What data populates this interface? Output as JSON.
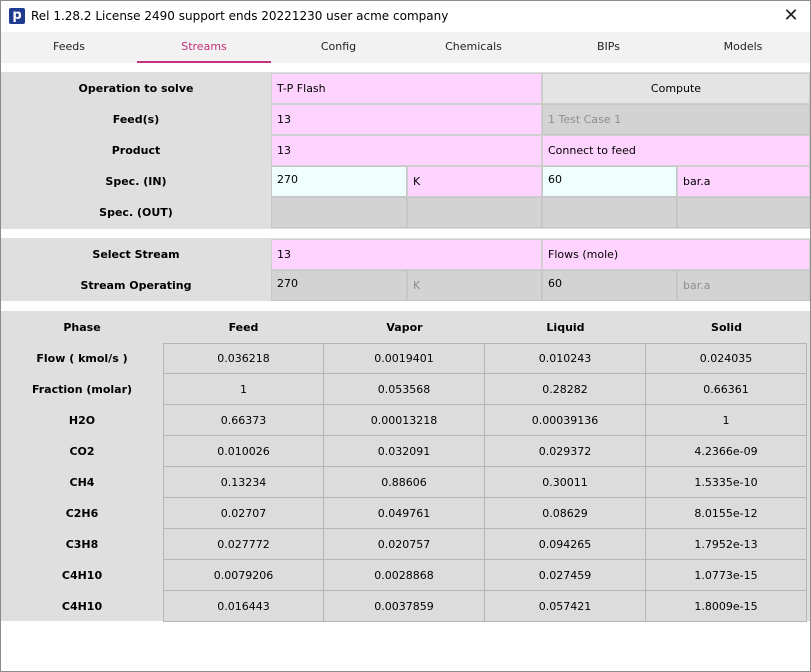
{
  "window": {
    "icon_glyph": "p",
    "title": "Rel 1.28.2 License 2490 support ends 20221230 user acme company",
    "close_glyph": "✕"
  },
  "tabs": [
    {
      "label": "Feeds",
      "active": false
    },
    {
      "label": "Streams",
      "active": true
    },
    {
      "label": "Config",
      "active": false
    },
    {
      "label": "Chemicals",
      "active": false
    },
    {
      "label": "BIPs",
      "active": false
    },
    {
      "label": "Models",
      "active": false
    }
  ],
  "operation": {
    "operation_label": "Operation to solve",
    "operation_value": "T-P Flash",
    "compute_label": "Compute",
    "feeds_label": "Feed(s)",
    "feeds_value": "13",
    "feeds_select": "1  Test Case 1",
    "product_label": "Product",
    "product_value": "13",
    "product_option": "Connect to feed",
    "spec_in_label": "Spec. (IN)",
    "spec_in_temp": "270",
    "spec_in_temp_unit": "K",
    "spec_in_press": "60",
    "spec_in_press_unit": "bar.a",
    "spec_out_label": "Spec. (OUT)"
  },
  "stream": {
    "select_label": "Select Stream",
    "select_value": "13",
    "basis_value": "Flows (mole)",
    "operating_label": "Stream Operating",
    "op_temp": "270",
    "op_temp_unit": "K",
    "op_press": "60",
    "op_press_unit": "bar.a"
  },
  "results": {
    "columns": [
      "Phase",
      "Feed",
      "Vapor",
      "Liquid",
      "Solid"
    ],
    "rows": [
      {
        "label": "Flow ( kmol/s )",
        "values": [
          "0.036218",
          "0.0019401",
          "0.010243",
          "0.024035"
        ]
      },
      {
        "label": "Fraction (molar)",
        "values": [
          "1",
          "0.053568",
          "0.28282",
          "0.66361"
        ]
      },
      {
        "label": "H2O",
        "values": [
          "0.66373",
          "0.00013218",
          "0.00039136",
          "1"
        ]
      },
      {
        "label": "CO2",
        "values": [
          "0.010026",
          "0.032091",
          "0.029372",
          "4.2366e-09"
        ]
      },
      {
        "label": "CH4",
        "values": [
          "0.13234",
          "0.88606",
          "0.30011",
          "1.5335e-10"
        ]
      },
      {
        "label": "C2H6",
        "values": [
          "0.02707",
          "0.049761",
          "0.08629",
          "8.0155e-12"
        ]
      },
      {
        "label": "C3H8",
        "values": [
          "0.027772",
          "0.020757",
          "0.094265",
          "1.7952e-13"
        ]
      },
      {
        "label": "C4H10",
        "values": [
          "0.0079206",
          "0.0028868",
          "0.027459",
          "1.0773e-15"
        ]
      },
      {
        "label": "C4H10",
        "values": [
          "0.016443",
          "0.0037859",
          "0.057421",
          "1.8009e-15"
        ]
      }
    ]
  },
  "colors": {
    "accent": "#c4307b",
    "input_pink": "#ffd3ff",
    "input_cyan": "#effffe",
    "panel_gray": "#dfdfdf"
  }
}
